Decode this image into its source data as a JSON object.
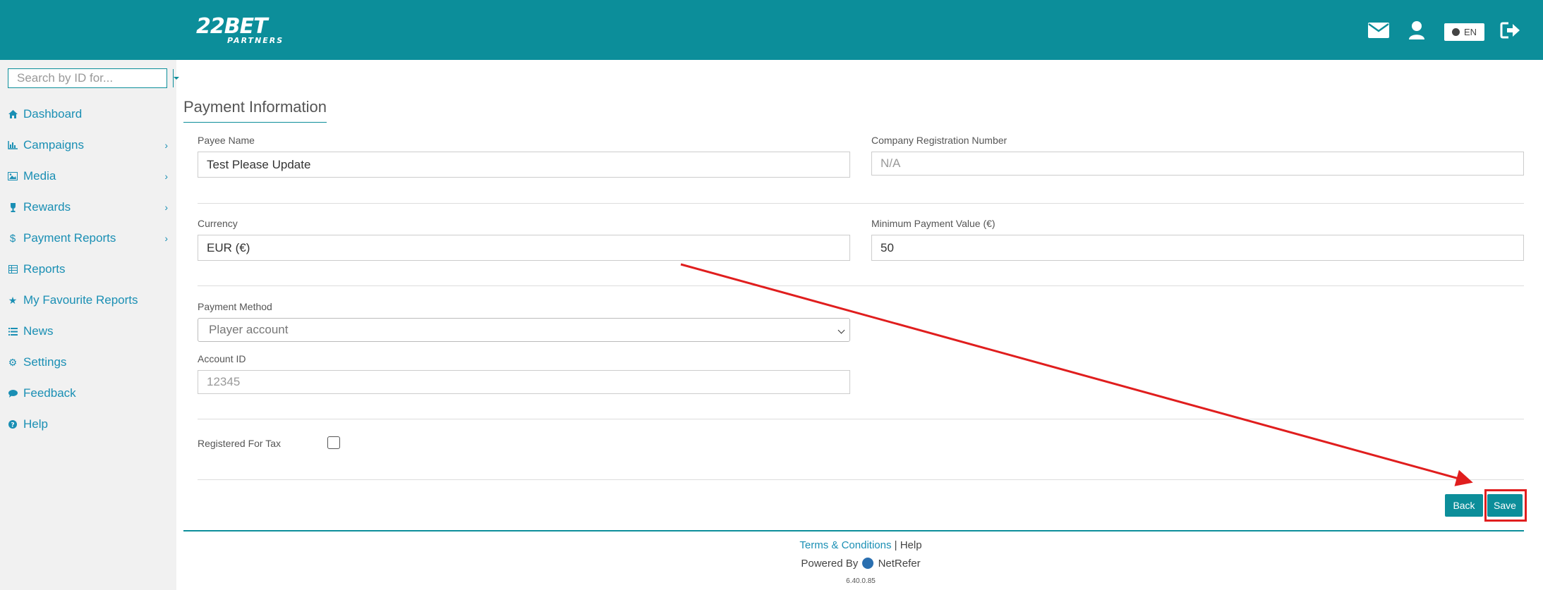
{
  "header": {
    "logo_main": "22BET",
    "logo_sub": "PARTNERS",
    "lang_label": "EN",
    "icons": [
      "mail-icon",
      "user-icon",
      "globe-icon",
      "logout-icon"
    ]
  },
  "sidebar": {
    "search_placeholder": "Search by ID for...",
    "items": [
      {
        "label": "Dashboard",
        "icon": "home-icon",
        "has_submenu": false
      },
      {
        "label": "Campaigns",
        "icon": "bar-chart-icon",
        "has_submenu": true
      },
      {
        "label": "Media",
        "icon": "image-icon",
        "has_submenu": true
      },
      {
        "label": "Rewards",
        "icon": "trophy-icon",
        "has_submenu": true
      },
      {
        "label": "Payment Reports",
        "icon": "dollar-icon",
        "has_submenu": true
      },
      {
        "label": "Reports",
        "icon": "table-icon",
        "has_submenu": false
      },
      {
        "label": "My Favourite Reports",
        "icon": "star-icon",
        "has_submenu": false
      },
      {
        "label": "News",
        "icon": "list-icon",
        "has_submenu": false
      },
      {
        "label": "Settings",
        "icon": "gear-icon",
        "has_submenu": false
      },
      {
        "label": "Feedback",
        "icon": "comment-icon",
        "has_submenu": false
      },
      {
        "label": "Help",
        "icon": "question-circle-icon",
        "has_submenu": false
      }
    ]
  },
  "main": {
    "title": "Payment Information",
    "payee_name": {
      "label": "Payee Name",
      "value": "Test Please Update"
    },
    "company_reg": {
      "label": "Company Registration Number",
      "value": "N/A"
    },
    "currency": {
      "label": "Currency",
      "value": "EUR (€)"
    },
    "min_payment": {
      "label": "Minimum Payment Value (€)",
      "value": "50"
    },
    "payment_method": {
      "label": "Payment Method",
      "value": "Player account"
    },
    "account_id": {
      "label": "Account ID",
      "value": "12345"
    },
    "registered_for_tax": {
      "label": "Registered For Tax",
      "checked": false
    },
    "back_label": "Back",
    "save_label": "Save"
  },
  "footer": {
    "terms_label": "Terms & Conditions",
    "separator": "|",
    "help_label": "Help",
    "powered_by": "Powered By",
    "netrefer": "NetRefer",
    "version": "6.40.0.85"
  },
  "colors": {
    "brand": "#0c8e9a",
    "link": "#1a8fb4",
    "annotation": "#e01e1e"
  }
}
